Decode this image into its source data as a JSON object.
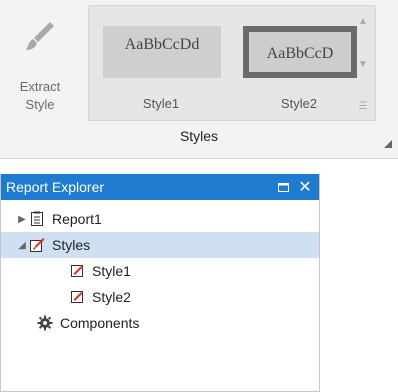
{
  "ribbon": {
    "extract_label": "Extract\nStyle",
    "group_label": "Styles",
    "gallery": [
      {
        "preview": "AaBbCcDd",
        "label": "Style1"
      },
      {
        "preview": "AaBbCcD",
        "label": "Style2"
      }
    ]
  },
  "explorer": {
    "title": "Report Explorer",
    "nodes": {
      "report": "Report1",
      "styles": "Styles",
      "style1": "Style1",
      "style2": "Style2",
      "components": "Components"
    }
  },
  "colors": {
    "header_bg": "#1e7bd0",
    "selection_bg": "#cfe0f3",
    "icon_red": "#d9332c"
  }
}
